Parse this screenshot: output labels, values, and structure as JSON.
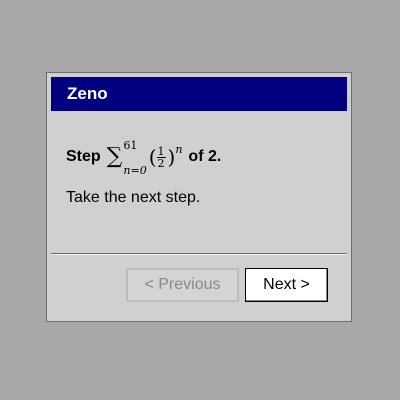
{
  "dialog": {
    "title": "Zeno",
    "step": {
      "prefix": "Step",
      "sum_upper": "61",
      "sum_lower": "n=0",
      "fraction_numerator": "1",
      "fraction_denominator": "2",
      "exponent": "n",
      "suffix": "of 2."
    },
    "message": "Take the next step.",
    "buttons": {
      "previous_label": "< Previous",
      "previous_enabled": false,
      "next_label": "Next >"
    }
  }
}
